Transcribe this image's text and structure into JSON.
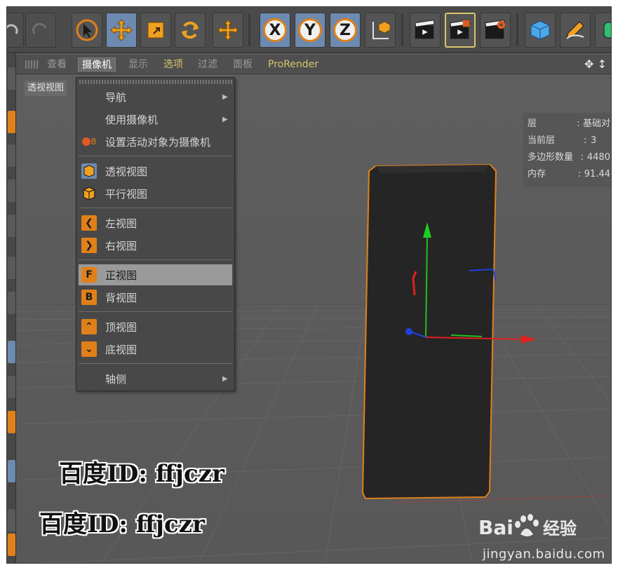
{
  "toolbar": {
    "axes": [
      "X",
      "Y",
      "Z"
    ]
  },
  "menubar": {
    "items": [
      "查看",
      "摄像机",
      "显示",
      "选项",
      "过滤",
      "面板",
      "ProRender"
    ]
  },
  "viewport": {
    "label": "透视视图"
  },
  "hud": {
    "rows": [
      {
        "key": "层",
        "sep": ":",
        "value": "基础对"
      },
      {
        "key": "当前层",
        "sep": ":",
        "value": "3"
      },
      {
        "key": "多边形数量",
        "sep": ":",
        "value": "4480"
      },
      {
        "key": "内存",
        "sep": ":",
        "value": "91.44"
      }
    ]
  },
  "camera_menu": {
    "items": [
      {
        "label": "导航",
        "icon": "none",
        "submenu": true
      },
      {
        "label": "使用摄像机",
        "icon": "none",
        "submenu": true
      },
      {
        "label": "设置活动对象为摄像机",
        "icon": "set-camera-icon",
        "submenu": false
      },
      {
        "label": "透视视图",
        "icon": "perspective-cube-icon",
        "submenu": false
      },
      {
        "label": "平行视图",
        "icon": "parallel-cube-icon",
        "submenu": false
      },
      {
        "label": "左视图",
        "icon": "left-arrow-icon",
        "glyph": "❮",
        "submenu": false
      },
      {
        "label": "右视图",
        "icon": "right-arrow-icon",
        "glyph": "❯",
        "submenu": false
      },
      {
        "label": "正视图",
        "icon": "front-view-icon",
        "glyph": "F",
        "submenu": false,
        "highlighted": true
      },
      {
        "label": "背视图",
        "icon": "back-view-icon",
        "glyph": "B",
        "submenu": false
      },
      {
        "label": "顶视图",
        "icon": "top-view-icon",
        "glyph": "⌃",
        "submenu": false
      },
      {
        "label": "底视图",
        "icon": "bottom-view-icon",
        "glyph": "⌄",
        "submenu": false
      },
      {
        "label": "轴侧",
        "icon": "none",
        "submenu": true
      }
    ]
  },
  "watermarks": {
    "line1": "百度ID: ffjczr",
    "line2": "百度ID: ffjczr"
  },
  "baidu": {
    "logo_text": "Bai",
    "logo_text2": "经验",
    "url": "jingyan.baidu.com"
  },
  "colors": {
    "accent_orange": "#e0801a",
    "active_blue": "#6d8ab0",
    "axis_x": "#e02020",
    "axis_y": "#20c020",
    "axis_z": "#2040e0"
  }
}
